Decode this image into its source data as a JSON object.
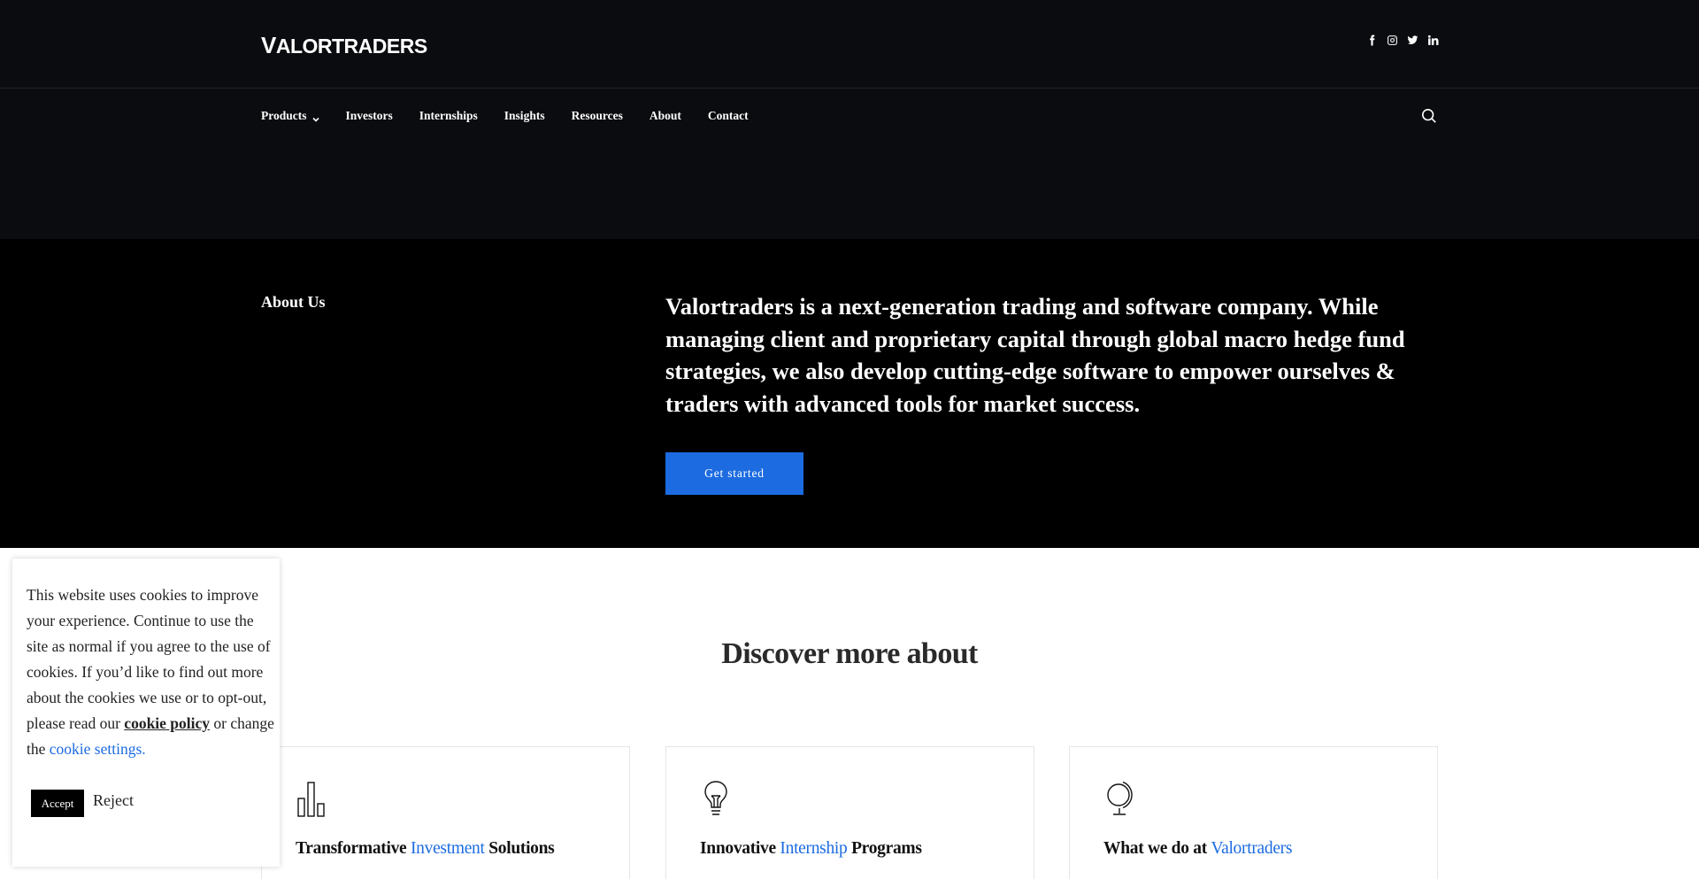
{
  "brand": {
    "logo_text_lead": "V",
    "logo_text_rest": "ALORTRADERS"
  },
  "social": {
    "icons": [
      "facebook-icon",
      "instagram-icon",
      "twitter-icon",
      "linkedin-icon"
    ]
  },
  "nav": {
    "items": [
      {
        "label": "Products",
        "has_dropdown": true
      },
      {
        "label": "Investors"
      },
      {
        "label": "Internships"
      },
      {
        "label": "Insights"
      },
      {
        "label": "Resources"
      },
      {
        "label": "About"
      },
      {
        "label": "Contact"
      }
    ]
  },
  "about": {
    "label": "About Us",
    "text": "Valortraders is a next-generation trading and software company. While managing client and proprietary capital through global macro hedge fund strategies, we also develop cutting-edge software to empower ourselves & traders with advanced tools for market success.",
    "cta_label": "Get started"
  },
  "discover": {
    "heading": "Discover more about",
    "cards": [
      {
        "icon": "bar-chart-icon",
        "pre": "Transformative ",
        "highlight": "Investment",
        "post": " Solutions"
      },
      {
        "icon": "lightbulb-icon",
        "pre": "Innovative ",
        "highlight": "Internship",
        "post": " Programs"
      },
      {
        "icon": "globe-icon",
        "pre": "What we do at ",
        "highlight": "Valortraders",
        "post": ""
      }
    ]
  },
  "cookie": {
    "message": "This website uses cookies to improve your experience. Continue to use the site as normal if you agree to the use of cookies. If you’d like to find out more about the cookies we use or to opt-out, please read our",
    "policy_link": "cookie policy",
    "middle": " or change the ",
    "settings_link": "cookie settings.",
    "accept_label": "Accept",
    "reject_label": "Reject"
  },
  "colors": {
    "accent": "#1c6be1",
    "header_bg": "#0b0c0f",
    "about_bg": "#000000"
  }
}
